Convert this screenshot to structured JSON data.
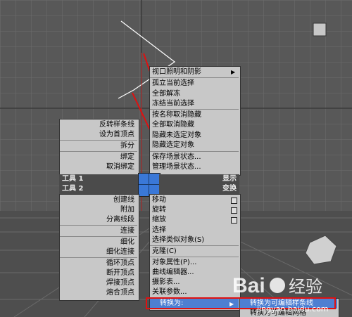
{
  "quad_top_right": [
    {
      "label": "视口照明和阴影",
      "submenu": true
    },
    {
      "label": "孤立当前选择"
    },
    {
      "label": "全部解冻"
    },
    {
      "label": "冻结当前选择"
    },
    {
      "label": "按名称取消隐藏"
    },
    {
      "label": "全部取消隐藏"
    },
    {
      "label": "隐藏未选定对象"
    },
    {
      "label": "隐藏选定对象"
    },
    {
      "label": "保存场景状态..."
    },
    {
      "label": "管理场景状态..."
    }
  ],
  "quad_top_left": [
    {
      "label": "反转样条线"
    },
    {
      "label": "设为首顶点"
    },
    {
      "label": "拆分"
    },
    {
      "label": "绑定"
    },
    {
      "label": "取消绑定"
    }
  ],
  "headers": {
    "tools1": "工具 1",
    "tools2": "工具 2",
    "display": "显示",
    "transform": "变换"
  },
  "quad_bottom_left": [
    {
      "label": "创建线"
    },
    {
      "label": "附加"
    },
    {
      "label": "分离线段"
    },
    {
      "label": "连接"
    },
    {
      "label": "细化"
    },
    {
      "label": "细化连接"
    },
    {
      "label": "循环顶点"
    },
    {
      "label": "断开顶点"
    },
    {
      "label": "焊接顶点"
    },
    {
      "label": "熔合顶点"
    }
  ],
  "quad_bottom_right": [
    {
      "label": "移动",
      "box": true
    },
    {
      "label": "旋转",
      "box": true
    },
    {
      "label": "缩放",
      "box": true
    },
    {
      "label": "选择"
    },
    {
      "label": "选择类似对象(S)"
    },
    {
      "label": "克隆(C)"
    },
    {
      "label": "对象属性(P)..."
    },
    {
      "label": "曲线编辑器..."
    },
    {
      "label": "摄影表..."
    },
    {
      "label": "关联参数..."
    },
    {
      "label": "转换为:",
      "submenu": true
    }
  ],
  "submenu": [
    {
      "label": "转换为可编辑样条线"
    },
    {
      "label": "转换为可编辑网格"
    }
  ],
  "watermark": {
    "logo": "Bai 经验",
    "url": "jingyan.baidu.com"
  },
  "colors": {
    "menu_bg": "#c8c8c8",
    "header_bg": "#4b4b4b",
    "highlight": "#4e7fd1",
    "annotation": "#e01010",
    "grid": "#7a7a7a"
  }
}
